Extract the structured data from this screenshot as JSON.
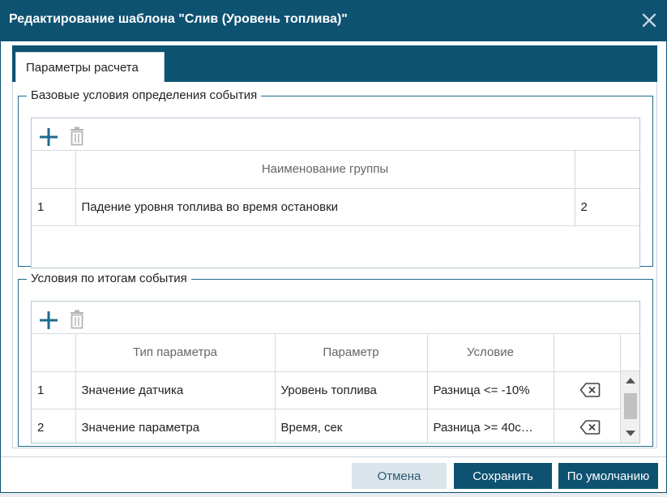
{
  "dialog": {
    "title": "Редактирование шаблона \"Слив (Уровень топлива)\"",
    "close_icon": "close-icon"
  },
  "tabs": [
    {
      "label": "Параметры расчета",
      "active": true
    }
  ],
  "base_conditions": {
    "legend": "Базовые условия определения события",
    "toolbar": {
      "add_icon": "plus-icon",
      "delete_icon": "trash-icon"
    },
    "columns": [
      "",
      "Наименование группы",
      ""
    ],
    "rows": [
      {
        "num": "1",
        "name": "Падение уровня топлива во время остановки",
        "count": "2"
      }
    ]
  },
  "result_conditions": {
    "legend": "Условия по итогам события",
    "toolbar": {
      "add_icon": "plus-icon",
      "delete_icon": "trash-icon"
    },
    "columns": [
      "",
      "Тип параметра",
      "Параметр",
      "Условие",
      ""
    ],
    "rows": [
      {
        "num": "1",
        "type": "Значение датчика",
        "param": "Уровень топлива",
        "condition": "Разница <= -10%",
        "remove_icon": "backspace-icon"
      },
      {
        "num": "2",
        "type": "Значение параметра",
        "param": "Время, сек",
        "condition": "Разница >= 40с…",
        "remove_icon": "backspace-icon"
      }
    ]
  },
  "buttons": {
    "cancel": "Отмена",
    "save": "Сохранить",
    "default": "По умолчанию"
  },
  "colors": {
    "header": "#0e5272",
    "accent": "#1e6a8e",
    "cancel_bg": "#dbe4ea"
  }
}
